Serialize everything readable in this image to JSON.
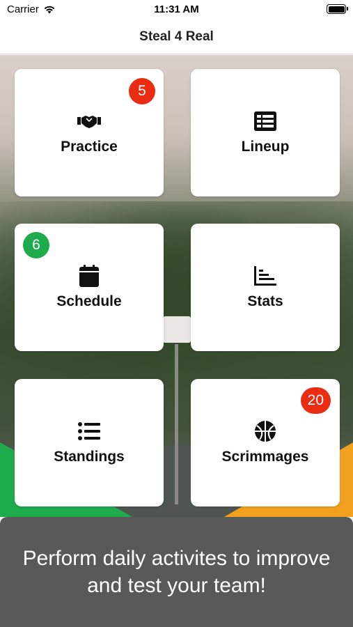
{
  "status_bar": {
    "carrier": "Carrier",
    "time": "11:31 AM"
  },
  "nav": {
    "title": "Steal 4 Real"
  },
  "tiles": [
    {
      "label": "Practice",
      "icon": "handshake-icon",
      "badge": "5",
      "badge_color": "#ea2c12"
    },
    {
      "label": "Lineup",
      "icon": "table-list-icon"
    },
    {
      "label": "Schedule",
      "icon": "calendar-icon",
      "badge": "6",
      "badge_color": "#1eab4c"
    },
    {
      "label": "Stats",
      "icon": "chart-bar-icon"
    },
    {
      "label": "Standings",
      "icon": "list-icon"
    },
    {
      "label": "Scrimmages",
      "icon": "basketball-icon",
      "badge": "20",
      "badge_color": "#ea2c12"
    }
  ],
  "footer": {
    "text": "Perform daily activites to improve and test your team!"
  },
  "colors": {
    "accent_green": "#1eab4c",
    "accent_orange": "#f2a11f",
    "footer_bg": "#595959"
  }
}
